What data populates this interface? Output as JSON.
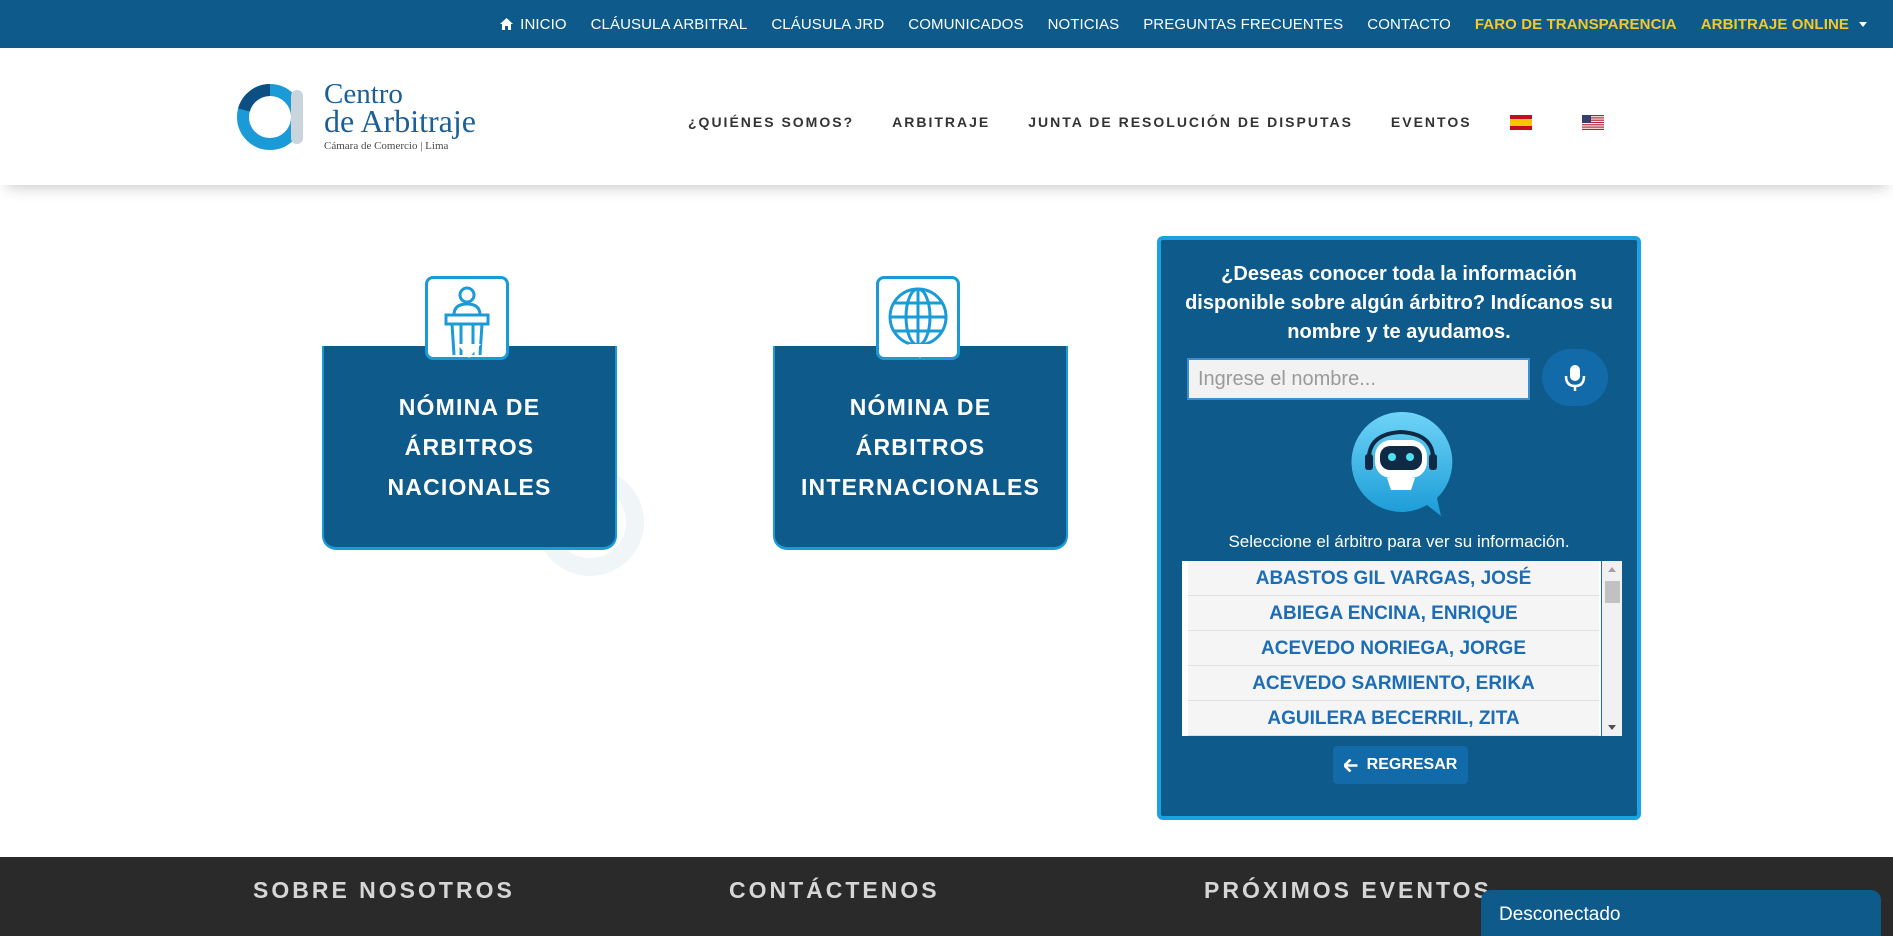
{
  "topnav": {
    "items": [
      {
        "label": "INICIO"
      },
      {
        "label": "CLÁUSULA ARBITRAL"
      },
      {
        "label": "CLÁUSULA JRD"
      },
      {
        "label": "COMUNICADOS"
      },
      {
        "label": "NOTICIAS"
      },
      {
        "label": "PREGUNTAS FRECUENTES"
      },
      {
        "label": "CONTACTO"
      },
      {
        "label": "FARO DE TRANSPARENCIA"
      },
      {
        "label": "ARBITRAJE ONLINE"
      }
    ],
    "highlight_color": "#f5c928",
    "background": "#0e5a8a"
  },
  "logo": {
    "line1": "Centro",
    "line2": "de Arbitraje",
    "line3": "Cámara de Comercio | Lima"
  },
  "mainnav": {
    "items": [
      {
        "label": "¿QUIÉNES SOMOS?"
      },
      {
        "label": "ARBITRAJE"
      },
      {
        "label": "JUNTA DE RESOLUCIÓN DE DISPUTAS"
      },
      {
        "label": "EVENTOS"
      }
    ],
    "flags": [
      "spain-flag-icon",
      "usa-flag-icon"
    ]
  },
  "cards": [
    {
      "line1": "NÓMINA DE",
      "line2": "ÁRBITROS",
      "line3": "NACIONALES",
      "icon": "lectern-person-icon"
    },
    {
      "line1": "NÓMINA DE",
      "line2": "ÁRBITROS",
      "line3": "INTERNACIONALES",
      "icon": "globe-icon"
    }
  ],
  "panel": {
    "question": "¿Deseas conocer toda la información disponible sobre algún árbitro? Indícanos su nombre y te ayudamos.",
    "input_placeholder": "Ingrese el nombre...",
    "select_text": "Seleccione el árbitro para ver su información.",
    "arbitrators": [
      "ABASTOS GIL VARGAS, JOSÉ",
      "ABIEGA ENCINA, ENRIQUE",
      "ACEVEDO NORIEGA, JORGE",
      "ACEVEDO SARMIENTO, ERIKA",
      "AGUILERA BECERRIL, ZITA"
    ],
    "back_label": "REGRESAR",
    "border_color": "#1aa3e0"
  },
  "footer": {
    "col1": "SOBRE NOSOTROS",
    "col2": "CONTÁCTENOS",
    "col3": "PRÓXIMOS EVENTOS"
  },
  "chat": {
    "status": "Desconectado"
  }
}
